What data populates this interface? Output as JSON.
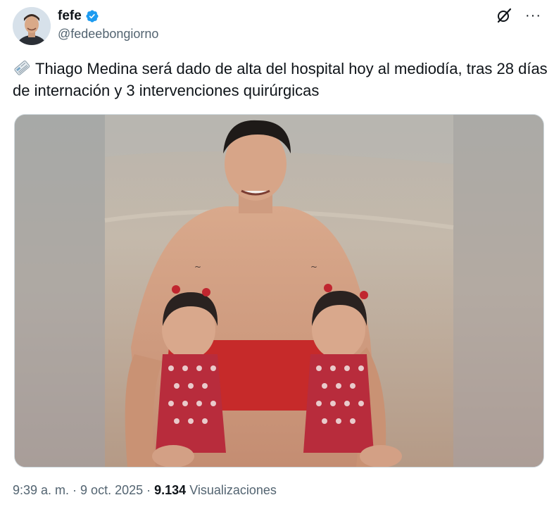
{
  "author": {
    "display_name": "fefe",
    "handle": "@fedeebongiorno",
    "verified": true,
    "verified_color": "#1d9bf0"
  },
  "icons": {
    "grok": "grok-icon",
    "more": "more-icon",
    "more_glyph": "···",
    "newspaper": "newspaper-emoji"
  },
  "tweet": {
    "text": "Thiago Medina será dado de alta del hospital hoy al mediodía, tras 28 días de internación y 3 intervenciones quirúrgicas"
  },
  "meta": {
    "time": "9:39 a. m.",
    "separator": " · ",
    "date": "9 oct. 2025",
    "views_count": "9.134",
    "views_label": "Visualizaciones"
  }
}
